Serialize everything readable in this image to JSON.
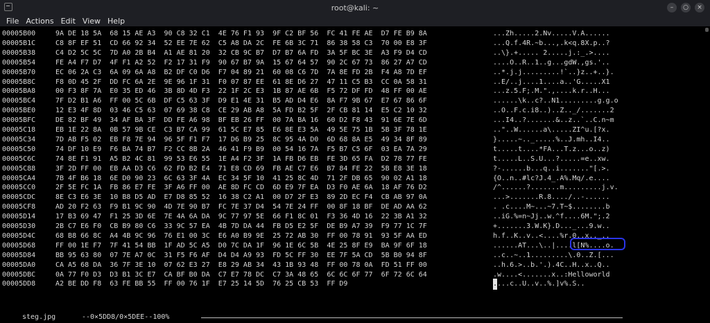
{
  "window": {
    "title": "root@kali: ~"
  },
  "menu": [
    "File",
    "Actions",
    "Edit",
    "View",
    "Help"
  ],
  "rows": [
    {
      "addr": "00005B00",
      "bytes": "9A DE 18 5A  68 15 AE A3  90 C8 32 C1  4E 76 F1 93  9F C2 BF 56  FC 41 FE AE  D7 FE B9 8A",
      "ascii": "...Zh.....2.Nv.....V.A......"
    },
    {
      "addr": "00005B1C",
      "bytes": "C8 8F EF 51  CD 66 92 34  52 EE 7E 62  C5 A8 DA 2C  FE 6B 3C 71  86 38 58 C3  70 00 E8 3F",
      "ascii": "...Q.f.4R.~b...,.k<q.8X.p..?"
    },
    {
      "addr": "00005B38",
      "bytes": "C4 D2 5C 5C  7D A0 2B B4  A1 AE 81 20  32 CB 9C B7  D7 B7 6A FD  3A 5F BC 3E  A3 F9 D4 CD",
      "ascii": "..\\}.+..... 2.....j.:_.>...."
    },
    {
      "addr": "00005B54",
      "bytes": "FE A4 F7 D7  4F F1 A2 52  F2 17 31 F9  90 67 B7 9A  15 67 64 57  90 2C 67 73  86 27 A7 CD",
      "ascii": "....O..R..1..g...gdW.,gs.'.."
    },
    {
      "addr": "00005B70",
      "bytes": "EC 06 2A C3  6A 09 6A A8  B2 DF C0 D6  F7 04 89 21  60 08 C6 7D  7A 8E FD 2B  F4 A8 7D EF",
      "ascii": "..*.j.j.........!`..}z..+..}."
    },
    {
      "addr": "00005B8C",
      "bytes": "F8 0D 45 2F  DD FC 6A 2E  9E 96 1F 31  F0 07 87 EE  61 8E D6 27  47 11 C5 B3  CC 0A 58 31",
      "ascii": "..E/..j....1....a..'G.....X1"
    },
    {
      "addr": "00005BA8",
      "bytes": "00 F3 8F 7A  E0 35 ED 46  3B 8D 4D F3  22 1F 2C E3  1B 87 AE 6B  F5 72 DF FD  48 FF 00 AE",
      "ascii": "...z.5.F;.M.\".,....k.r..H..."
    },
    {
      "addr": "00005BC4",
      "bytes": "7F D2 B1 A6  FF 00 5C 6B  DF C5 63 3F  D9 E1 4E 31  B5 AD D4 E6  8A F7 9B 67  E7 67 86 6F",
      "ascii": "......\\k..c?..N1.........g.g.o"
    },
    {
      "addr": "00005BE0",
      "bytes": "12 E3 4F 8D  03 46 C5 63  07 69 38 C8  CE 29 AB A8  5A FD B2 5F  2F CB 81 14  E5 C2 10 32",
      "ascii": "..O..F.c.i8..)..Z.._/.......2"
    },
    {
      "addr": "00005BFC",
      "bytes": "DE 82 BF 49  34 AF BA 3F  DD FE A6 98  BF EB 26 FF  00 7A BA 16  60 D2 F8 43  91 6E 7E 6D",
      "ascii": "...I4..?.......&..z..`..C.n~m"
    },
    {
      "addr": "00005C18",
      "bytes": "EB 1E 22 8A  0B 57 9B CE  C3 B7 CA 99  61 5C E7 85  E6 8E E3 5A  49 5E 75 1B  5B 3F 78 1E",
      "ascii": "..\"..W......a\\.....ZI^u.[?x."
    },
    {
      "addr": "00005C34",
      "bytes": "7D AB F5 02  EB F8 7E 94  96 5F F1 F7  17 D6 B9 25  8C 95 4A D0  6D 68 8A E5  49 34 8F 89",
      "ascii": "}.....~.._.....%..J.mh..I4.."
    },
    {
      "addr": "00005C50",
      "bytes": "74 DF 10 E9  F6 BA 74 B7  F2 CC 8B 2A  46 41 F9 B9  00 54 16 7A  F5 B7 C5 6F  03 EA 7A 29",
      "ascii": "t.....t....*FA...T.z...o..z)"
    },
    {
      "addr": "00005C6C",
      "bytes": "74 8E F1 91  A5 B2 4C 81  99 53 E6 55  1E A4 F2 3F  1A FB D6 EB  FE 3D 65 FA  D2 78 77 FE",
      "ascii": "t.....L..S.U...?.....=e..xw."
    },
    {
      "addr": "00005C88",
      "bytes": "3F 2D FF 00  EB AA D3 C6  62 FD B2 E4  71 E8 CD 69  FB AE C7 E6  B7 84 FE 22  5B E8 3E 18",
      "ascii": "?-......b...q..i.......\"[.>."
    },
    {
      "addr": "00005CA4",
      "bytes": "7B 4F B6 18  6E D0 90 23  6C 63 3F 4A  EC 34 5F 10  41 25 8C 4D  71 2F DB 65  90 02 A1 18",
      "ascii": "{O..n..#lc?J.4_.A%.Mq/.e...."
    },
    {
      "addr": "00005CC0",
      "bytes": "2F 5E FC 1A  FB 86 E7 FE  3F A6 FF 00  AE 8D FC CD  6D E9 7F EA  D3 F0 AE 6A  18 AF 76 D2",
      "ascii": "/^......?.......m.........j.v."
    },
    {
      "addr": "00005CDC",
      "bytes": "8E C3 E6 3E  10 B8 D5 AD  E7 D8 85 52  16 38 C2 A1  00 D7 2F E3  89 2D EC F4  CB AB 97 0A",
      "ascii": "...>.......R.8..../..-......"
    },
    {
      "addr": "00005CF8",
      "bytes": "AD 20 F2 63  F9 B1 9C 90  4D 7E 90 B7  FC 7E 37 D4  54 7E 24 FF  00 8F 18 BF  DE AD AA 62",
      "ascii": ". .c....M~...~7.T~$........b"
    },
    {
      "addr": "00005D14",
      "bytes": "17 B3 69 47  F1 25 3D 6E  7E 4A 6A DA  9C 77 97 5E  66 F1 8C 01  F3 36 4D 16  22 3B A1 32",
      "ascii": "..iG.%=n~Jj..w.^f....6M.\";.2"
    },
    {
      "addr": "00005D30",
      "bytes": "2B C7 E6 F0  CB B9 80 C6  33 9C 57 EA  4B 7D DA 44  FB D5 E2 5F  DE B9 A7 39  F9 77 1C 7F",
      "ascii": "+.......3.W.K}.D..._...9.w.."
    },
    {
      "addr": "00005D4C",
      "bytes": "68 B8 66 8C  A4 4B 9C 96  76 E1 00 3C  E6 A0 B9 9E  25 72 AB 30  FF 00 78 91  93 5F AA ED",
      "ascii": "h.f..K..v..<....%r.0..x.._.."
    },
    {
      "addr": "00005D68",
      "bytes": "FF 00 1E F7  7F 41 54 BB  1F AD 5C A5  D0 7C DA 1F  96 1E 6C 5B  4E 25 8F E9  BA 9F 6F 18",
      "ascii": "......AT...\\..|....l[N%....o."
    },
    {
      "addr": "00005D84",
      "bytes": "BB 95 63 80  07 7E A7 0C  31 F5 F6 AF  D4 D4 A9 93  FD 5C FF 30  EE 7F 5A CD  5B B0 94 8F",
      "ascii": "..c..~..1.........\\.0..Z.[..."
    },
    {
      "addr": "00005DA0",
      "bytes": "CA A5 68 DA  36 7F 3E 10  07 62 E3 27  E8 29 AB 34  43 1B 93 48  FF 00 78 0A  FD 51 FF 00",
      "ascii": "..h.6.>..b.'.).4C..H..x..Q.."
    },
    {
      "addr": "00005DBC",
      "bytes": "0A 77 F0 D3  D3 B1 3C E7  CA BF B0 DA  C7 E7 78 DC  C7 3A 48 65  6C 6C 6F 77  6F 72 6C 64",
      "ascii": ".w....<.......x..:Helloworld"
    },
    {
      "addr": "00005DD8",
      "bytes": "A2 BE DD F8  63 FE BB 55  FF 00 76 1F  E7 25 14 5D  76 25 CB 53  FF D9",
      "ascii_cursor": ".",
      "ascii": "...c..U..v..%.]v%.S.."
    }
  ],
  "status": {
    "filename": "steg.jpg",
    "position": "--0×5DD8/0×5DEE--100%"
  }
}
